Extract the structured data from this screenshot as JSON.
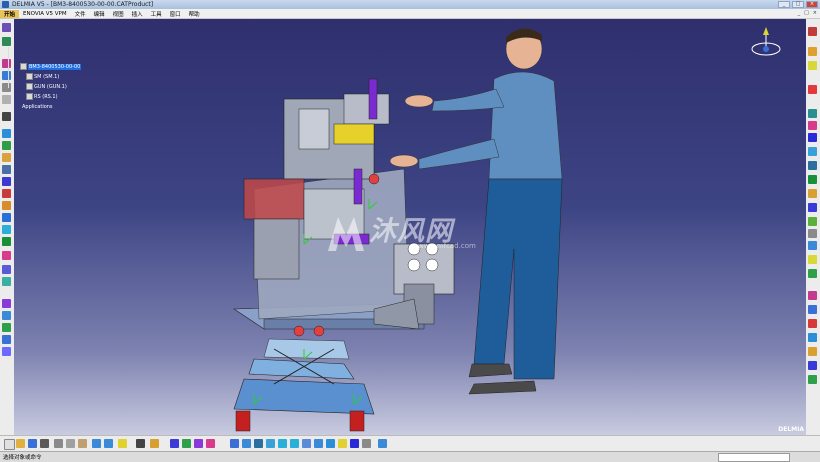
{
  "window": {
    "title": "DELMIA V5 - [BM3-8400530-00-00.CATProduct]",
    "controls": [
      "_",
      "□",
      "×"
    ]
  },
  "menubar": {
    "items": [
      "开始",
      "ENOVIA V5 VPM",
      "文件",
      "编辑",
      "视图",
      "插入",
      "工具",
      "窗口",
      "帮助"
    ],
    "active_index": 0,
    "right_controls": [
      "_",
      "□",
      "×"
    ]
  },
  "tree": {
    "root": "BM3-8400530-00-00",
    "children": [
      "SM (SM.1)",
      "GUN (GUN.1)",
      "RS (RS.1)"
    ],
    "applications": "Applications"
  },
  "watermark": {
    "text": "沐风网",
    "subtext": "www.mfcad.com"
  },
  "status": {
    "message": "选择对象或命令"
  },
  "brand": "DELMIA",
  "colors": {
    "selection": "#1f6fe0",
    "active_menu": "#e8c25a",
    "viewport_top": "#2f2f6e",
    "viewport_bottom": "#c9cbe0"
  }
}
